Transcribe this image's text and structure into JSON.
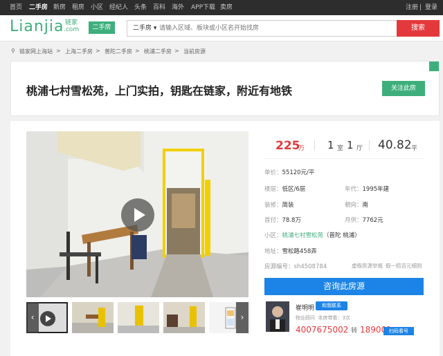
{
  "topnav": {
    "items": [
      "首页",
      "二手房",
      "新房",
      "租房",
      "小区",
      "经纪人",
      "头条",
      "百科",
      "海外",
      "APP下载",
      "卖房"
    ],
    "active": "二手房",
    "register": "注册",
    "sep": "|",
    "login": "登录"
  },
  "header": {
    "logo_text": "Lianjia",
    "logo_sub_1": "链家",
    "logo_sub_2": ".com",
    "tag": "二手房",
    "search_type": "二手房 ▾",
    "search_placeholder": "请输入区域、板块或小区名开始找房",
    "search_button": "搜索"
  },
  "breadcrumb": {
    "items": [
      "链家网上海站",
      "上海二手房",
      "普陀二手房",
      "桃浦二手房",
      "当前房源"
    ],
    "separator": ">"
  },
  "listing": {
    "title": "桃浦七村雪松苑，上门实拍，钥匙在链家，附近有地铁",
    "follow_button": "关注此房"
  },
  "price": {
    "total": "225",
    "total_unit": "万",
    "rooms": "1",
    "rooms_unit": "室",
    "halls": "1",
    "halls_unit": "厅",
    "area": "40.82",
    "area_unit": "平"
  },
  "details": {
    "unit_price_label": "单价：",
    "unit_price": "55120元/平",
    "floor_label": "楼层：",
    "floor": "低区/6层",
    "year_label": "年代：",
    "year": "1995年建",
    "decor_label": "装修：",
    "decor": "简装",
    "orientation_label": "朝向：",
    "orientation": "南",
    "down_label": "首付：",
    "down": "78.8万",
    "monthly_label": "月供：",
    "monthly": "7762元",
    "community_label": "小区：",
    "community": "桃浦七村雪松苑",
    "community_area": "（普陀 桃浦）",
    "address_label": "地址：",
    "address": "雪松路458弄",
    "listing_id_label": "房源编号：",
    "listing_id": "sh4508784",
    "report_link": "虚假房源举报",
    "guarantee_link": "假一赔百元细则"
  },
  "actions": {
    "consult": "咨询此房源"
  },
  "agent": {
    "name": "崔明明",
    "chat": "和我联系",
    "role": "物业顾问",
    "views": "本房带看：3次",
    "phone": "4007675002",
    "ext_label": "转",
    "ext": "189001",
    "qr_button": "扫码看号"
  },
  "gallery": {
    "prev": "‹",
    "next": "›"
  },
  "colors": {
    "brand_green": "#3eaf7c",
    "price_red": "#e4393c",
    "action_blue": "#1c84e6"
  }
}
